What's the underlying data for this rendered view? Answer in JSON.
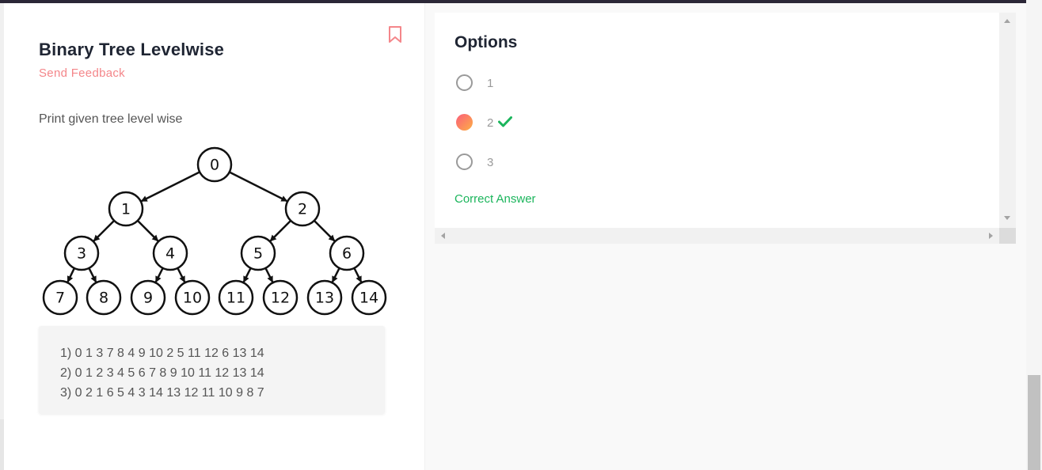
{
  "question": {
    "title": "Binary Tree Levelwise",
    "feedback_label": "Send Feedback",
    "description": "Print given tree level wise",
    "tree_nodes": [
      "0",
      "1",
      "2",
      "3",
      "4",
      "5",
      "6",
      "7",
      "8",
      "9",
      "10",
      "11",
      "12",
      "13",
      "14"
    ],
    "choices_text": [
      "1) 0 1 3 7 8 4 9 10 2 5 11 12 6 13 14",
      "2) 0 1 2 3 4 5 6 7 8 9 10 11 12 13 14",
      "3) 0 2 1 6 5 4 3 14 13 12 11 10 9 8 7"
    ]
  },
  "options": {
    "title": "Options",
    "items": [
      {
        "label": "1",
        "selected": false
      },
      {
        "label": "2",
        "selected": true,
        "correct": true
      },
      {
        "label": "3",
        "selected": false
      }
    ],
    "result_text": "Correct Answer"
  },
  "colors": {
    "accent": "#f4868a",
    "correct": "#1bb55c",
    "topbar": "#2b2737"
  },
  "icons": {
    "bookmark": "bookmark-icon",
    "check": "checkmark-icon"
  }
}
